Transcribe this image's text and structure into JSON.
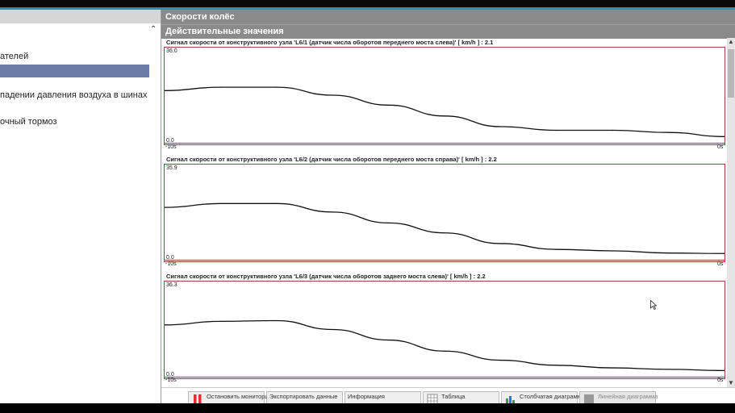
{
  "left_panel": {
    "items": [
      {
        "label": "ателей"
      },
      {
        "label": ""
      },
      {
        "label": " падении давления воздуха в шинах"
      },
      {
        "label": "очный тормоз"
      }
    ],
    "collapse_icon": "chevron-up-icon"
  },
  "header": {
    "title": "Скорости колёс",
    "subtitle": "Действительные значения"
  },
  "charts": [
    {
      "title": "Сигнал скорости от конструктивного узла 'L6/1 (датчик числа оборотов переднего моста слева)' [ km/h ] : 2.1",
      "ymax": "36.0",
      "ymin": "0.0",
      "x_start": "-10s",
      "x_end": "0s"
    },
    {
      "title": "Сигнал скорости от конструктивного узла 'L6/2 (датчик числа оборотов переднего моста справа)' [ km/h ] : 2.2",
      "ymax": "35.9",
      "ymin": "0.0",
      "x_start": "-10s",
      "x_end": "0s"
    },
    {
      "title": "Сигнал скорости от конструктивного узла 'L6/3 (датчик числа оборотов заднего моста слева)' [ km/h ] : 2.2",
      "ymax": "36.3",
      "ymin": "0.0",
      "x_start": "-10s",
      "x_end": "0s"
    }
  ],
  "chart_data": [
    {
      "type": "line",
      "title": "Сигнал скорости от конструктивного узла 'L6/1 (датчик числа оборотов переднего моста слева)' [ km/h ] : 2.1",
      "x": [
        -10,
        -9,
        -8,
        -7,
        -6,
        -5,
        -4,
        -3,
        -2,
        -1,
        0
      ],
      "values": [
        20.9,
        22.3,
        22.3,
        19.0,
        14.9,
        10.4,
        6.0,
        4.5,
        4.5,
        3.6,
        1.9
      ],
      "ylim": [
        0,
        36.0
      ],
      "xlim": [
        -10,
        0
      ]
    },
    {
      "type": "line",
      "title": "Сигнал скорости от конструктивного узла 'L6/2 (датчик числа оборотов переднего моста справа)' [ km/h ] : 2.2",
      "x": [
        -10,
        -9,
        -8,
        -7,
        -6,
        -5,
        -4,
        -3,
        -2,
        -1,
        0
      ],
      "values": [
        20.9,
        22.5,
        22.5,
        19.0,
        14.5,
        10.4,
        6.0,
        3.6,
        3.0,
        2.1,
        1.9
      ],
      "ylim": [
        0,
        35.9
      ],
      "xlim": [
        -10,
        0
      ]
    },
    {
      "type": "line",
      "title": "Сигнал скорости от конструктивного узла 'L6/3 (датчик числа оборотов заднего моста слева)' [ km/h ] : 2.2",
      "x": [
        -10,
        -9,
        -8,
        -7,
        -6,
        -5,
        -4,
        -3,
        -2,
        -1,
        0
      ],
      "values": [
        20.9,
        22.4,
        22.7,
        19.0,
        14.6,
        10.0,
        6.2,
        4.1,
        3.0,
        2.4,
        1.9
      ],
      "ylim": [
        0,
        36.3
      ],
      "xlim": [
        -10,
        0
      ]
    }
  ],
  "toolbar": {
    "stop_label": "Остановить мониторинг",
    "export_label": "Экспортировать данные",
    "info_label": "Информация",
    "table_label": "Таблица",
    "bar_label": "Столбчатая диаграмма",
    "line_label": "Линейная диаграмма"
  },
  "colors": {
    "accent": "#1e8fc9",
    "header_bg": "#8a8a8a",
    "selection": "#6b7ba8",
    "plot_border": "#a04040",
    "stop_icon": "#e03030"
  }
}
